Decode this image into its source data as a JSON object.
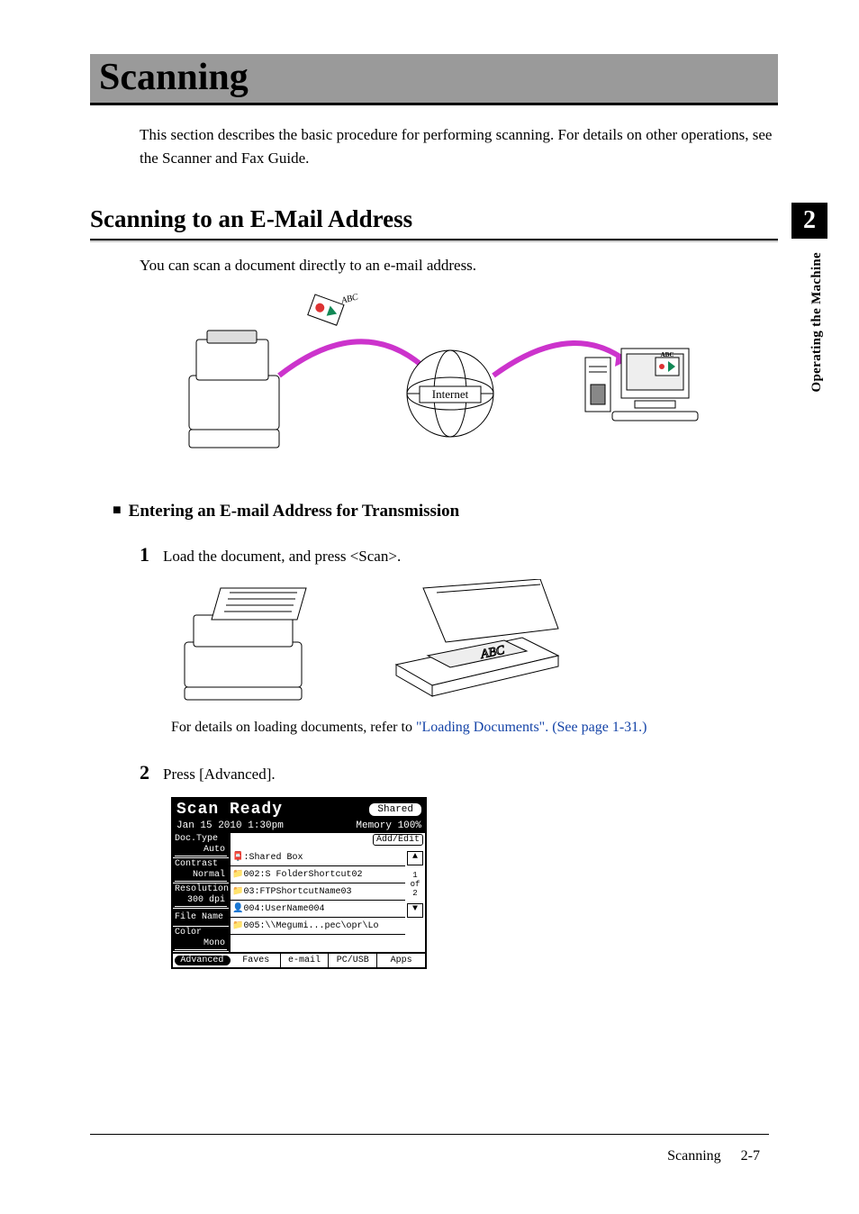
{
  "chapter": {
    "number": "2",
    "side_label": "Operating the Machine"
  },
  "title": "Scanning",
  "intro": "This section describes the basic procedure for performing scanning. For details on other operations, see the Scanner and Fax Guide.",
  "section": {
    "heading": "Scanning to an E-Mail Address",
    "intro": "You can scan a document directly to an e-mail address.",
    "diagram_label_internet": "Internet",
    "diagram_label_abc": "ABC"
  },
  "sub": {
    "heading": "Entering an E-mail Address for Transmission"
  },
  "steps": {
    "s1": {
      "num": "1",
      "text": "Load the document, and press <Scan>."
    },
    "ref_prefix": "For details on loading documents, refer to ",
    "ref_link": "\"Loading Documents\". (See page 1-31.)",
    "s2": {
      "num": "2",
      "text": "Press [Advanced]."
    }
  },
  "lcd": {
    "ready": "Scan Ready",
    "shared": "Shared",
    "date": "Jan 15 2010  1:30pm",
    "memory": "Memory  100%",
    "add_edit": "Add/Edit",
    "left": {
      "doctype": "Doc.Type",
      "doctype_v": "Auto",
      "contrast": "Contrast",
      "contrast_v": "Normal",
      "resolution": "Resolution",
      "resolution_v": "300 dpi",
      "filename": "File Name",
      "color": "Color",
      "color_v": "Mono"
    },
    "rows": {
      "r1": ":Shared Box",
      "r2": "002:S FolderShortcut02",
      "r3": "03:FTPShortcutName03",
      "r4": "004:UserName004",
      "r5": "005:\\\\Megumi...pec\\opr\\Lo"
    },
    "scroll": {
      "up": "▲",
      "page": "1\nof\n2",
      "down": "▼"
    },
    "bottom": {
      "adv": "Advanced",
      "faves": "Faves",
      "email": "e-mail",
      "pcusb": "PC/USB",
      "apps": "Apps"
    }
  },
  "footer": {
    "section": "Scanning",
    "page": "2-7"
  }
}
